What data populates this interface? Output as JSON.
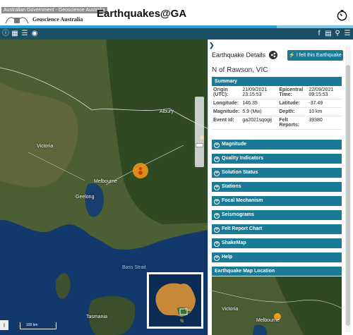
{
  "header": {
    "gov_label": "Australian Government - Geoscience Australia",
    "agency": "Geoscience Australia",
    "title": "Earthquakes@GA"
  },
  "map": {
    "labels": [
      "Albury",
      "Victoria",
      "Melbourne",
      "Geelong",
      "Bass Strait",
      "Tasmania"
    ],
    "scale": "100 km",
    "info": "i",
    "overview_label": "Tas"
  },
  "panel": {
    "title": "Earthquake Details",
    "felt_button": "I felt this Earthquake",
    "location": "N of Rawson, VIC",
    "summary_title": "Summary",
    "summary": [
      {
        "k1": "Origin (UTC):",
        "v1": "21/09/2021 23:15:53",
        "k2": "Epicentral Time:",
        "v2": "22/09/2021 09:15:53"
      },
      {
        "k1": "Longitude:",
        "v1": "146.35",
        "k2": "Latitude:",
        "v2": "-37.49"
      },
      {
        "k1": "Magnitude:",
        "v1": "5.9 (Mw)",
        "k2": "Depth:",
        "v2": "10 km"
      },
      {
        "k1": "Event Id:",
        "v1": "ga2021sqogij",
        "k2": "Felt Reports:",
        "v2": "39380"
      }
    ],
    "sections": [
      "Magnitude",
      "Quality Indicators",
      "Solution Status",
      "Stations",
      "Focal Mechanism",
      "Seismograms",
      "Felt Report Chart",
      "ShakeMap",
      "Help"
    ],
    "location_map_title": "Earthquake Map Location",
    "location_map_labels": [
      "Victoria",
      "Melbourne"
    ]
  }
}
